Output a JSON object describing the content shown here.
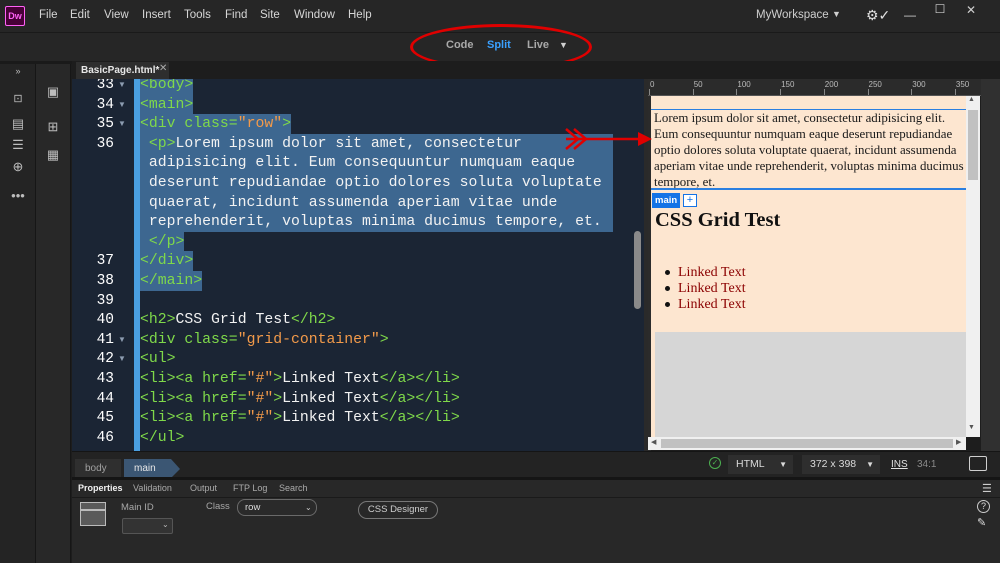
{
  "app": {
    "logo_text": "Dw",
    "accent_color": "#ff61f6"
  },
  "menu": [
    "File",
    "Edit",
    "View",
    "Insert",
    "Tools",
    "Find",
    "Site",
    "Window",
    "Help"
  ],
  "workspace": {
    "label": "MyWorkspace"
  },
  "view_switcher": {
    "code": "Code",
    "split": "Split",
    "live": "Live",
    "active": "Split",
    "active_color": "#3aa0ff"
  },
  "document": {
    "tab_label": "BasicPage.html*"
  },
  "code": {
    "lines": [
      {
        "n": "33",
        "fold": true,
        "parts": [
          [
            "tg",
            "<body>"
          ]
        ]
      },
      {
        "n": "34",
        "fold": true,
        "parts": [
          [
            "tg",
            "<main>"
          ]
        ]
      },
      {
        "n": "35",
        "fold": true,
        "parts": [
          [
            "tg",
            "<div "
          ],
          [
            "at",
            "class="
          ],
          [
            "st",
            "\"row\""
          ],
          [
            "tg",
            ">"
          ]
        ]
      },
      {
        "n": "36",
        "fold": false,
        "parts": [
          [
            "tx",
            " "
          ],
          [
            "tg",
            "<p>"
          ],
          [
            "tx",
            "Lorem ipsum dolor sit amet, consectetur"
          ]
        ]
      },
      {
        "n": "",
        "fold": false,
        "parts": [
          [
            "tx",
            " adipisicing elit. Eum consequuntur numquam eaque"
          ]
        ]
      },
      {
        "n": "",
        "fold": false,
        "parts": [
          [
            "tx",
            " deserunt repudiandae optio dolores soluta voluptate"
          ]
        ]
      },
      {
        "n": "",
        "fold": false,
        "parts": [
          [
            "tx",
            " quaerat, incidunt assumenda aperiam vitae unde"
          ]
        ]
      },
      {
        "n": "",
        "fold": false,
        "parts": [
          [
            "tx",
            " reprehenderit, voluptas minima ducimus tempore, et."
          ]
        ]
      },
      {
        "n": "",
        "fold": false,
        "parts": [
          [
            "tx",
            " "
          ],
          [
            "tg",
            "</p>"
          ]
        ]
      },
      {
        "n": "37",
        "fold": false,
        "parts": [
          [
            "tg",
            "</div>"
          ]
        ]
      },
      {
        "n": "38",
        "fold": false,
        "parts": [
          [
            "tg",
            "</main>"
          ]
        ]
      },
      {
        "n": "39",
        "fold": false,
        "parts": []
      },
      {
        "n": "40",
        "fold": false,
        "parts": [
          [
            "tg",
            "<h2>"
          ],
          [
            "tx",
            "CSS Grid Test"
          ],
          [
            "tg",
            "</h2>"
          ]
        ]
      },
      {
        "n": "41",
        "fold": true,
        "parts": [
          [
            "tg",
            "<div "
          ],
          [
            "at",
            "class="
          ],
          [
            "st",
            "\"grid-container\""
          ],
          [
            "tg",
            ">"
          ]
        ]
      },
      {
        "n": "42",
        "fold": true,
        "parts": [
          [
            "tg",
            "<ul>"
          ]
        ]
      },
      {
        "n": "43",
        "fold": false,
        "parts": [
          [
            "tg",
            "<li><a "
          ],
          [
            "at",
            "href="
          ],
          [
            "st",
            "\"#\""
          ],
          [
            "tg",
            ">"
          ],
          [
            "tx",
            "Linked Text"
          ],
          [
            "tg",
            "</a></li>"
          ]
        ]
      },
      {
        "n": "44",
        "fold": false,
        "parts": [
          [
            "tg",
            "<li><a "
          ],
          [
            "at",
            "href="
          ],
          [
            "st",
            "\"#\""
          ],
          [
            "tg",
            ">"
          ],
          [
            "tx",
            "Linked Text"
          ],
          [
            "tg",
            "</a></li>"
          ]
        ]
      },
      {
        "n": "45",
        "fold": false,
        "parts": [
          [
            "tg",
            "<li><a "
          ],
          [
            "at",
            "href="
          ],
          [
            "st",
            "\"#\""
          ],
          [
            "tg",
            ">"
          ],
          [
            "tx",
            "Linked Text"
          ],
          [
            "tg",
            "</a></li>"
          ]
        ]
      },
      {
        "n": "46",
        "fold": false,
        "parts": [
          [
            "tg",
            "</ul>"
          ]
        ]
      }
    ],
    "selected_lines": 11
  },
  "ruler": {
    "ticks": [
      "0",
      "50",
      "100",
      "150",
      "200",
      "250",
      "300",
      "350"
    ]
  },
  "live": {
    "paragraph": "Lorem ipsum dolor sit amet, consectetur adipisicing elit. Eum consequuntur numquam eaque deserunt repudiandae optio dolores soluta voluptate quaerat, incidunt assumenda aperiam vitae unde reprehenderit, voluptas minima ducimus tempore, et.",
    "badge": "main",
    "badge_plus": "+",
    "heading": "CSS Grid Test",
    "links": [
      "Linked Text",
      "Linked Text",
      "Linked Text"
    ]
  },
  "status": {
    "crumbs": [
      "body",
      "main"
    ],
    "doc_type": "HTML",
    "size": "372 x 398",
    "ins": "INS",
    "position": "34:1"
  },
  "properties": {
    "tabs": [
      "Properties",
      "Validation",
      "Output",
      "FTP Log",
      "Search"
    ],
    "main_id_label": "Main ID",
    "class_label": "Class",
    "class_value": "row",
    "css_designer": "CSS Designer"
  }
}
